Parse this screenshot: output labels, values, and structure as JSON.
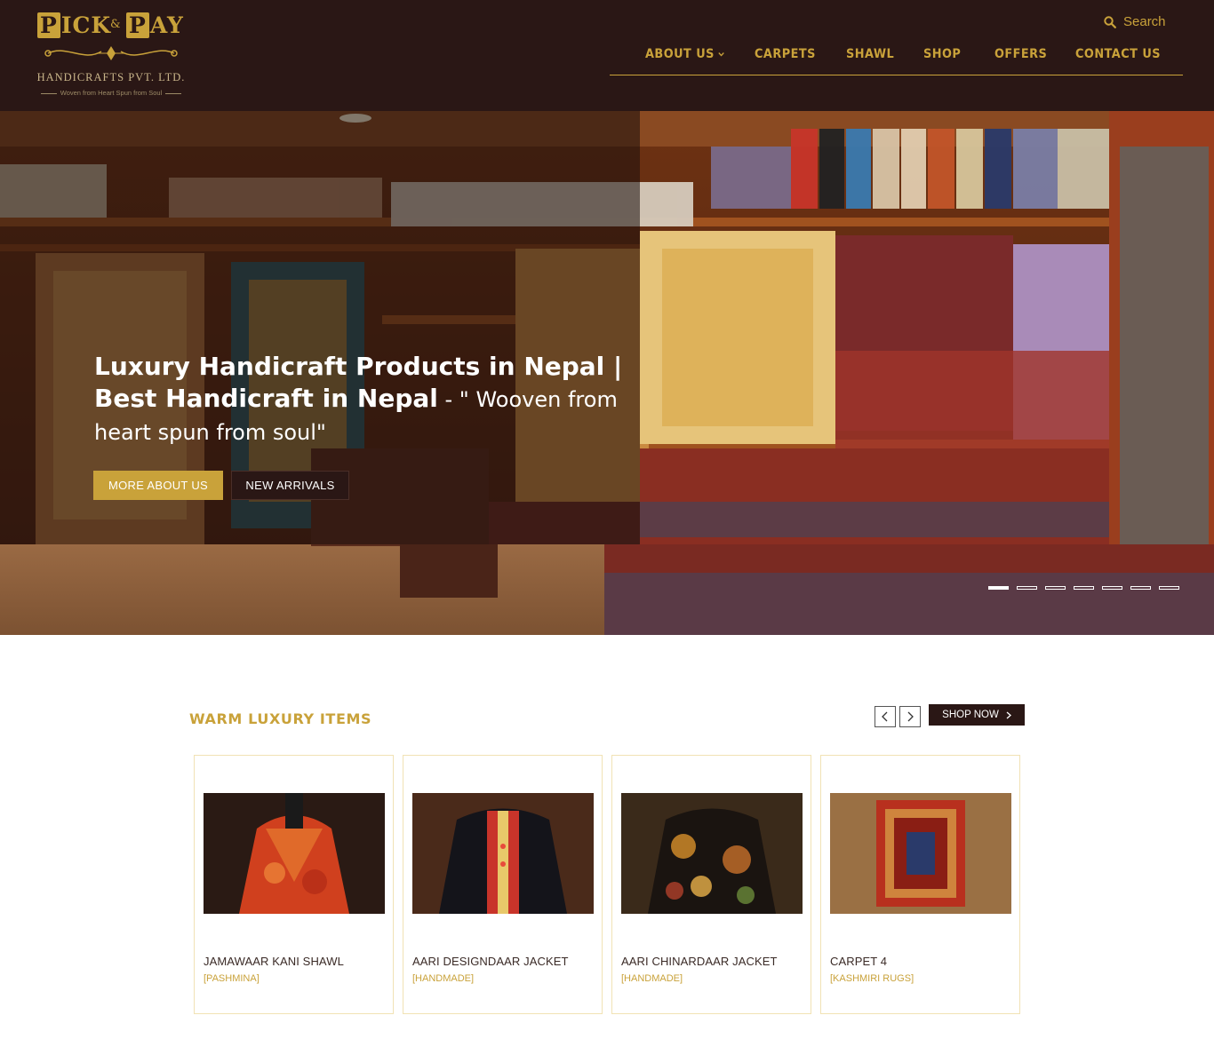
{
  "brand": {
    "word1": "PICK",
    "amp": "&",
    "word2": "PAY",
    "subtitle": "HANDICRAFTS PVT. LTD.",
    "tagline": "Woven from Heart Spun from Soul"
  },
  "header": {
    "search_label": "Search",
    "nav": [
      {
        "label": "ABOUT US",
        "has_dropdown": true
      },
      {
        "label": "CARPETS"
      },
      {
        "label": "SHAWL"
      },
      {
        "label": "SHOP"
      },
      {
        "label": "OFFERS"
      },
      {
        "label": "CONTACT US"
      }
    ]
  },
  "hero": {
    "title_bold": "Luxury Handicraft Products in Nepal | Best Handicraft in Nepal",
    "title_tail": " - \" Wooven from heart spun from soul\"",
    "btn_primary": "MORE ABOUT US",
    "btn_secondary": "NEW ARRIVALS",
    "slides_total": 7,
    "slide_active": 1
  },
  "products": {
    "section_title": "WARM LUXURY ITEMS",
    "shop_now": "SHOP NOW",
    "items": [
      {
        "name": "JAMAWAAR KANI SHAWL",
        "category": "[PASHMINA]"
      },
      {
        "name": "AARI DESIGNDAAR JACKET",
        "category": "[HANDMADE]"
      },
      {
        "name": "AARI CHINARDAAR JACKET",
        "category": "[HANDMADE]"
      },
      {
        "name": "CARPET 4",
        "category": "[KASHMIRI RUGS]"
      }
    ]
  },
  "colors": {
    "header_bg": "#2a1715",
    "gold": "#c9a23a",
    "card_border": "#f1e2b4"
  }
}
